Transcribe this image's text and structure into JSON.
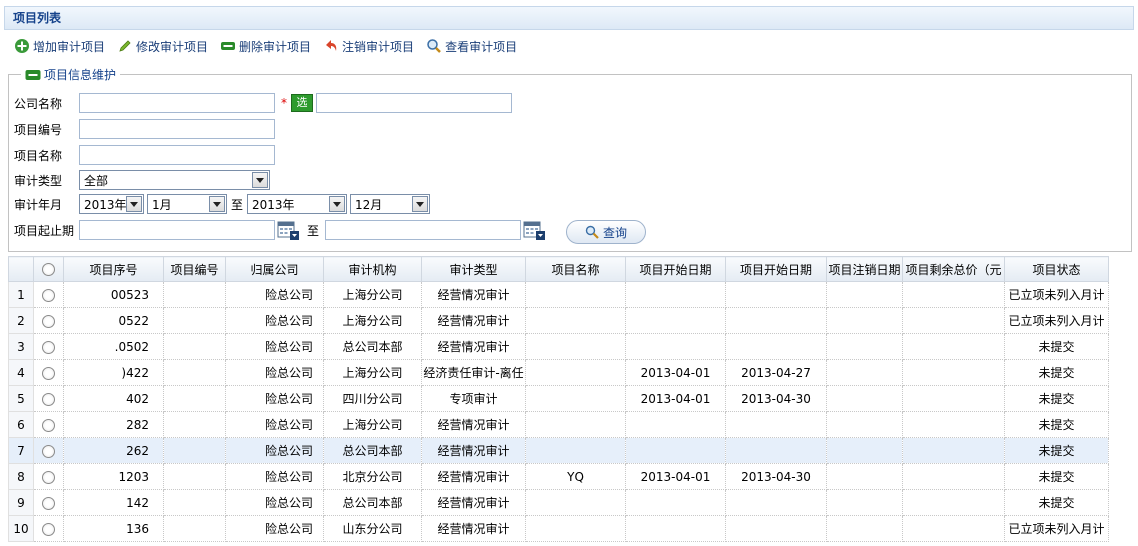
{
  "panel_title": "项目列表",
  "toolbar": [
    {
      "label": "增加审计项目",
      "icon": "add-icon"
    },
    {
      "label": "修改审计项目",
      "icon": "edit-icon"
    },
    {
      "label": "删除审计项目",
      "icon": "delete-icon"
    },
    {
      "label": "注销审计项目",
      "icon": "undo-icon"
    },
    {
      "label": "查看审计项目",
      "icon": "search-icon"
    }
  ],
  "form": {
    "legend": "项目信息维护",
    "company_label": "公司名称",
    "company_value": "",
    "required_mark": "*",
    "select_button": "选",
    "project_no_label": "项目编号",
    "project_name_label": "项目名称",
    "audit_type_label": "审计类型",
    "audit_type_value": "全部",
    "audit_month_label": "审计年月",
    "year_from": "2013年",
    "month_from": "1月",
    "to_1": "至",
    "year_to": "2013年",
    "month_to": "12月",
    "period_label": "项目起止期",
    "to_2": "至",
    "query_button": "查询"
  },
  "table": {
    "headers": [
      "项目序号",
      "项目编号",
      "归属公司",
      "审计机构",
      "审计类型",
      "项目名称",
      "项目开始日期",
      "项目开始日期",
      "项目注销日期",
      "项目剩余总价（元",
      "项目状态"
    ],
    "rows": [
      {
        "n": "1",
        "seq": "00523",
        "no": "",
        "company": "险总公司",
        "org": "上海分公司",
        "type": "经营情况审计",
        "name": "",
        "start": "",
        "end": "",
        "cancel": "",
        "remain": "",
        "status": "已立项未列入月计"
      },
      {
        "n": "2",
        "seq": "0522",
        "no": "",
        "company": "险总公司",
        "org": "上海分公司",
        "type": "经营情况审计",
        "name": "",
        "start": "",
        "end": "",
        "cancel": "",
        "remain": "",
        "status": "已立项未列入月计"
      },
      {
        "n": "3",
        "seq": ".0502",
        "no": "",
        "company": "险总公司",
        "org": "总公司本部",
        "type": "经营情况审计",
        "name": "",
        "start": "",
        "end": "",
        "cancel": "",
        "remain": "",
        "status": "未提交"
      },
      {
        "n": "4",
        "seq": ")422",
        "no": "",
        "company": "险总公司",
        "org": "上海分公司",
        "type": "经济责任审计-离任",
        "name": "",
        "start": "2013-04-01",
        "end": "2013-04-27",
        "cancel": "",
        "remain": "",
        "status": "未提交"
      },
      {
        "n": "5",
        "seq": "402",
        "no": "",
        "company": "险总公司",
        "org": "四川分公司",
        "type": "专项审计",
        "name": "",
        "start": "2013-04-01",
        "end": "2013-04-30",
        "cancel": "",
        "remain": "",
        "status": "未提交"
      },
      {
        "n": "6",
        "seq": "282",
        "no": "",
        "company": "险总公司",
        "org": "上海分公司",
        "type": "经营情况审计",
        "name": "",
        "start": "",
        "end": "",
        "cancel": "",
        "remain": "",
        "status": "未提交"
      },
      {
        "n": "7",
        "seq": "262",
        "no": "",
        "company": "险总公司",
        "org": "总公司本部",
        "type": "经营情况审计",
        "name": "",
        "start": "",
        "end": "",
        "cancel": "",
        "remain": "",
        "status": "未提交"
      },
      {
        "n": "8",
        "seq": "1203",
        "no": "",
        "company": "险总公司",
        "org": "北京分公司",
        "type": "经营情况审计",
        "name": "YQ",
        "start": "2013-04-01",
        "end": "2013-04-30",
        "cancel": "",
        "remain": "",
        "status": "未提交"
      },
      {
        "n": "9",
        "seq": "142",
        "no": "",
        "company": "险总公司",
        "org": "总公司本部",
        "type": "经营情况审计",
        "name": "",
        "start": "",
        "end": "",
        "cancel": "",
        "remain": "",
        "status": "未提交"
      },
      {
        "n": "10",
        "seq": "136",
        "no": "",
        "company": "险总公司",
        "org": "山东分公司",
        "type": "经营情况审计",
        "name": "",
        "start": "",
        "end": "",
        "cancel": "",
        "remain": "",
        "status": "已立项未列入月计"
      }
    ]
  },
  "colors": {
    "accent": "#15428b",
    "highlight_row": "#e6effa",
    "select_button": "#2e9b2e"
  }
}
